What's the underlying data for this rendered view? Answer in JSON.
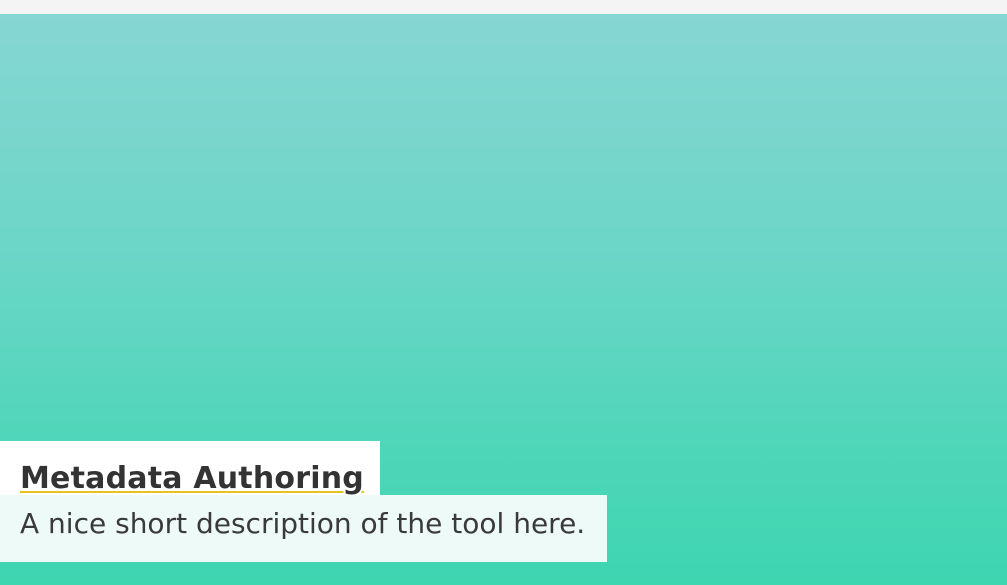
{
  "card": {
    "title": "Metadata Authoring",
    "description": "A nice short description of the tool here."
  },
  "colors": {
    "gradient_top": "#86d6d3",
    "gradient_bottom": "#3ed5b1",
    "title_underline": "#e8c21d",
    "title_text": "#333333"
  }
}
